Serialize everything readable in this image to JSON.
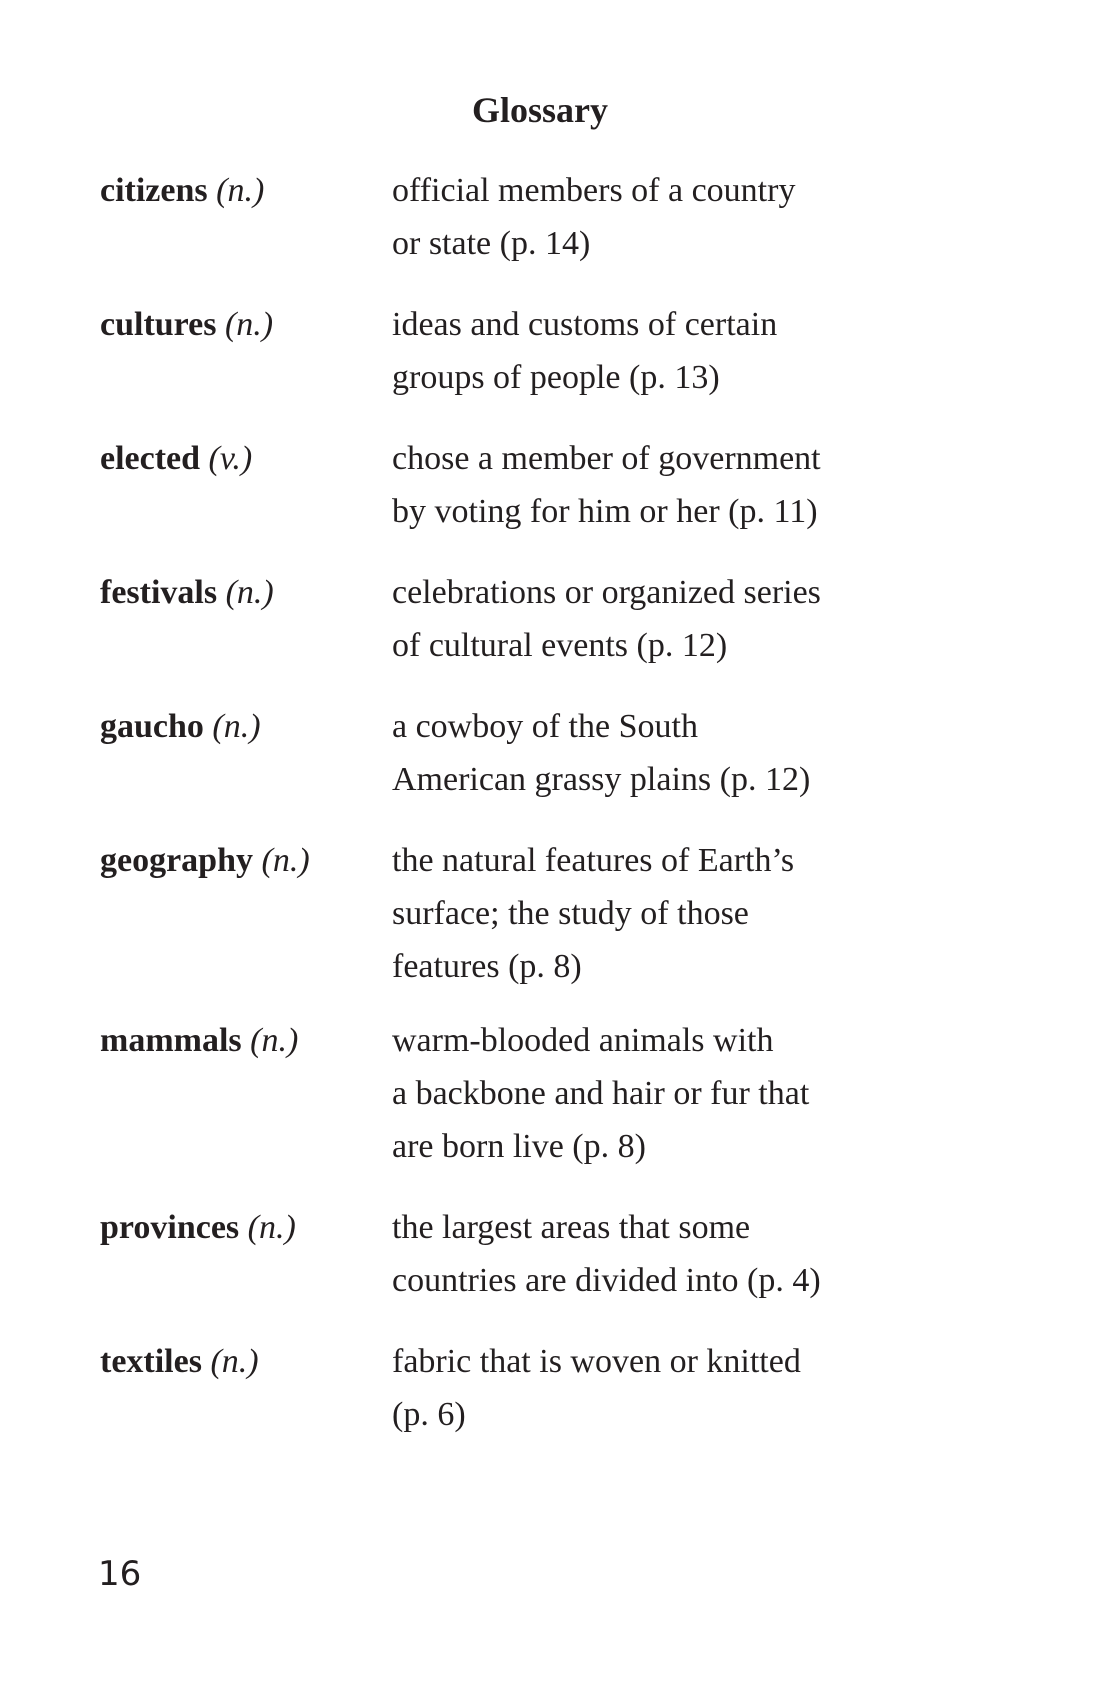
{
  "title": "Glossary",
  "entries": [
    {
      "term": "citizens",
      "pos": "(n.)",
      "lines": [
        "official members of a country",
        "or state (p. 14)"
      ]
    },
    {
      "term": "cultures",
      "pos": "(n.)",
      "lines": [
        "ideas and customs of certain",
        "groups of people (p. 13)"
      ]
    },
    {
      "term": "elected",
      "pos": "(v.)",
      "lines": [
        "chose a member of government",
        "by voting for him or her (p. 11)"
      ]
    },
    {
      "term": "festivals",
      "pos": "(n.)",
      "lines": [
        "celebrations or organized series",
        "of cultural events (p. 12)"
      ]
    },
    {
      "term": "gaucho",
      "pos": "(n.)",
      "lines": [
        "a cowboy of the South",
        "American grassy plains (p. 12)"
      ]
    },
    {
      "term": "geography",
      "pos": "(n.)",
      "lines": [
        "the natural features of Earth’s",
        "surface; the study of those",
        "features (p. 8)"
      ]
    },
    {
      "term": "mammals",
      "pos": "(n.)",
      "lines": [
        "warm-blooded animals with",
        "a backbone and hair or fur that",
        "are born live (p. 8)"
      ]
    },
    {
      "term": "provinces",
      "pos": "(n.)",
      "lines": [
        "the largest areas that some",
        "countries are divided into (p. 4)"
      ]
    },
    {
      "term": "textiles",
      "pos": "(n.)",
      "lines": [
        "fabric that is woven or knitted",
        "(p. 6)"
      ]
    }
  ],
  "page_number": "16"
}
